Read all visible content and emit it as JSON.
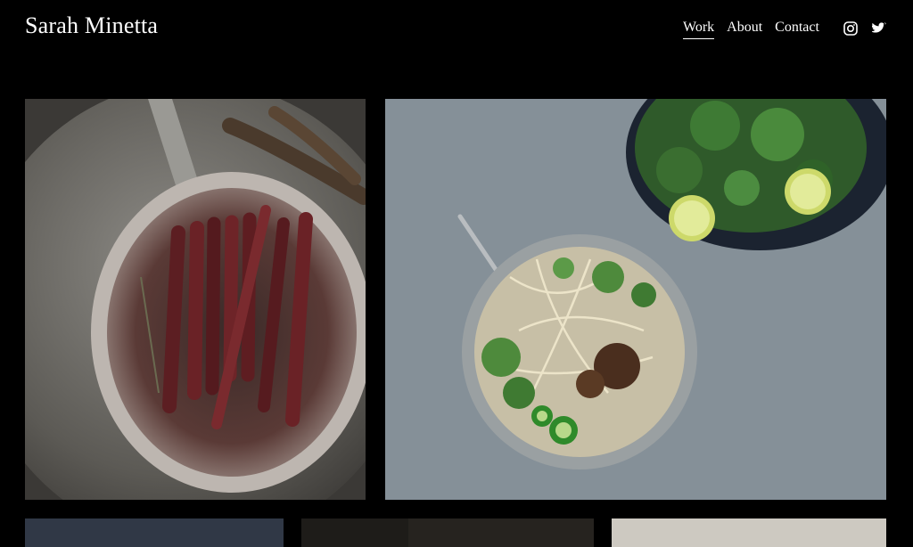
{
  "site": {
    "title": "Sarah Minetta"
  },
  "nav": {
    "items": [
      {
        "label": "Work",
        "active": true
      },
      {
        "label": "About",
        "active": false
      },
      {
        "label": "Contact",
        "active": false
      }
    ]
  },
  "social": [
    {
      "icon": "instagram-icon"
    },
    {
      "icon": "twitter-icon"
    }
  ],
  "colors": {
    "background": "#000000",
    "text": "#ffffff"
  }
}
